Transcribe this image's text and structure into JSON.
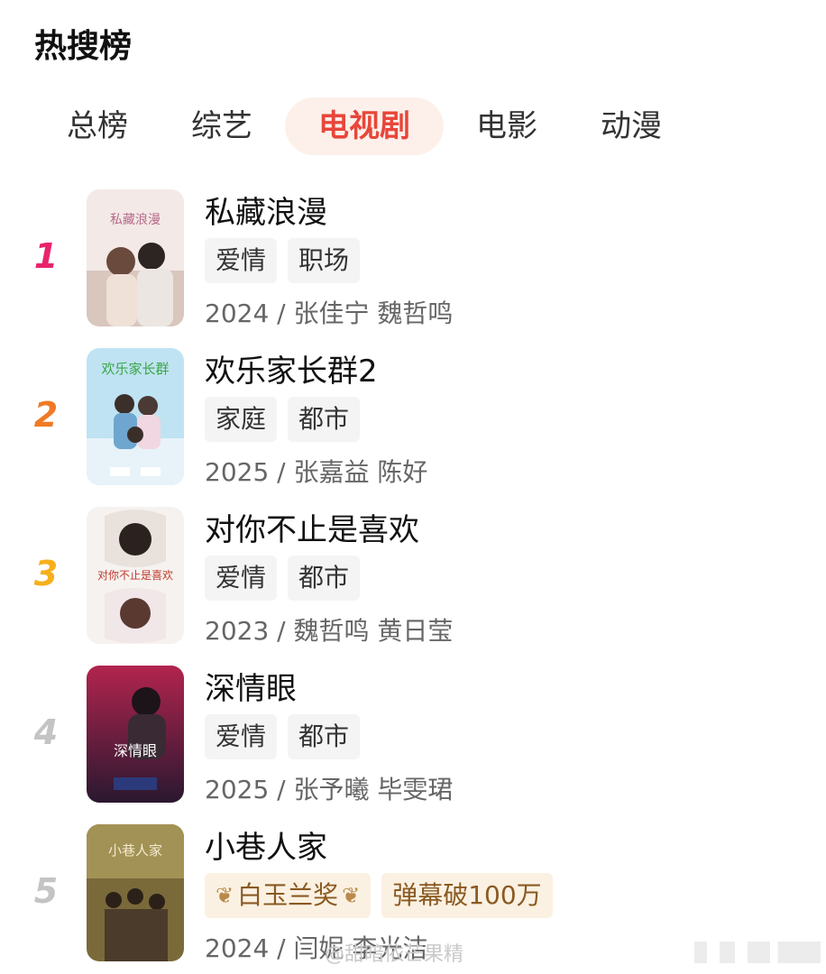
{
  "header": {
    "title": "热搜榜"
  },
  "tabs": [
    {
      "label": "总榜",
      "active": false
    },
    {
      "label": "综艺",
      "active": false
    },
    {
      "label": "电视剧",
      "active": true
    },
    {
      "label": "电影",
      "active": false
    },
    {
      "label": "动漫",
      "active": false
    }
  ],
  "colors": {
    "accent": "#e8463a",
    "rank1": "#e8246c",
    "rank2": "#f07a24",
    "rank3": "#f5b01c",
    "rank_other": "#c4c4c4"
  },
  "items": [
    {
      "rank": "1",
      "title": "私藏浪漫",
      "tags": [
        "爱情",
        "职场"
      ],
      "meta": "2024 / 张佳宁 魏哲鸣"
    },
    {
      "rank": "2",
      "title": "欢乐家长群2",
      "tags": [
        "家庭",
        "都市"
      ],
      "meta": "2025 / 张嘉益 陈好"
    },
    {
      "rank": "3",
      "title": "对你不止是喜欢",
      "tags": [
        "爱情",
        "都市"
      ],
      "meta": "2023 / 魏哲鸣 黄日莹"
    },
    {
      "rank": "4",
      "title": "深情眼",
      "tags": [
        "爱情",
        "都市"
      ],
      "meta": "2025 / 张予曦 毕雯珺"
    },
    {
      "rank": "5",
      "title": "小巷人家",
      "tags": [
        "白玉兰奖",
        "弹幕破100万"
      ],
      "meta": "2024 / 闫妮 李光洁"
    }
  ],
  "watermark": "@甜暗依芒果精"
}
